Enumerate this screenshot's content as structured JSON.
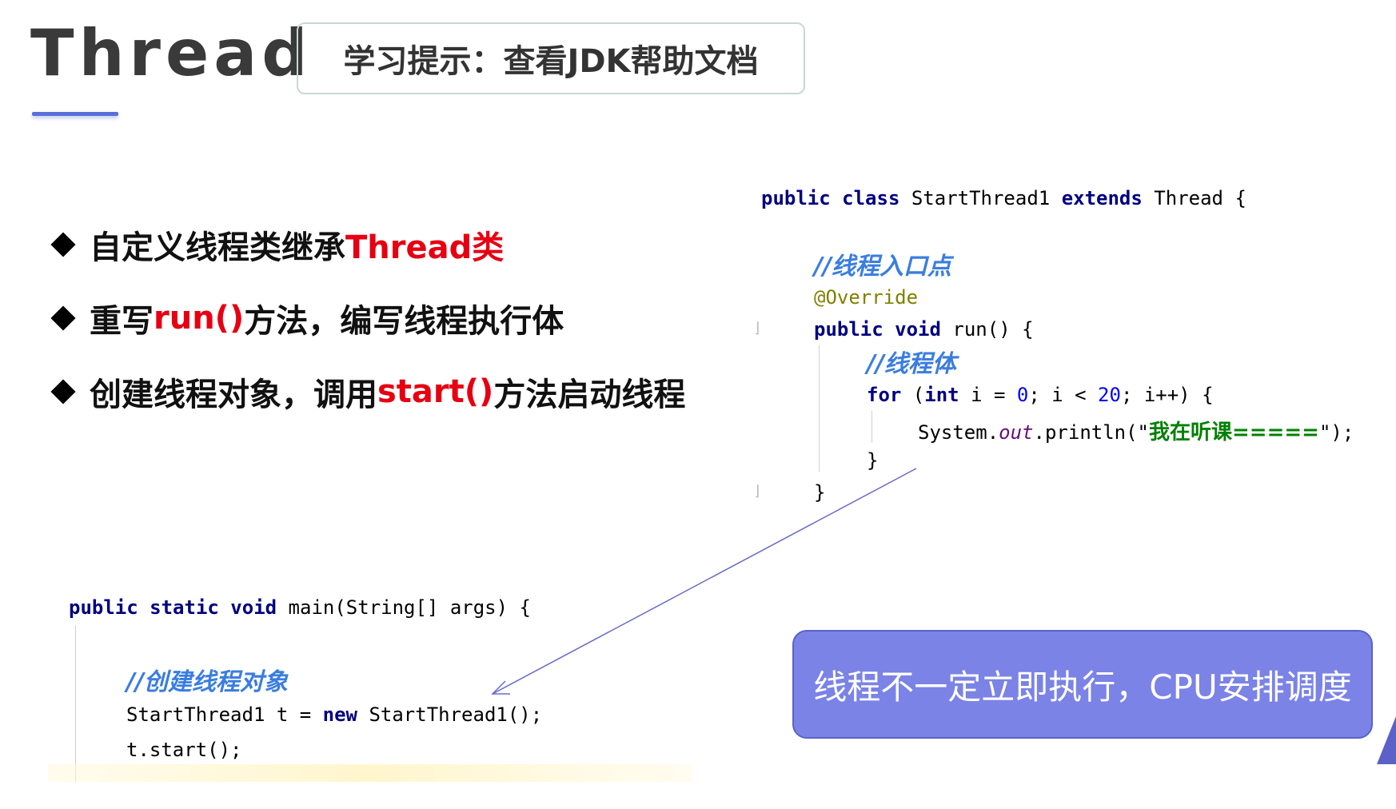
{
  "title": "Thread",
  "hint": "学习提示：查看JDK帮助文档",
  "bullets": [
    {
      "pre": "自定义线程类继承",
      "red": "Thread类",
      "post": ""
    },
    {
      "pre": "重写",
      "red": "run()",
      "post": "方法，编写线程执行体"
    },
    {
      "pre": "创建线程对象，调用",
      "red": "start()",
      "post": "方法启动线程"
    }
  ],
  "code_class": {
    "l1_kw": "public class",
    "l1_name": " StartThread1 ",
    "l1_ext": "extends",
    "l1_tail": " Thread {",
    "comment1": "//线程入口点",
    "annotation": "@Override",
    "l3_kw": "public void",
    "l3_tail": " run() {",
    "comment2": "//线程体",
    "for_kw": "for",
    "for_open": " (",
    "int_kw": "int",
    "for_mid1": " i = ",
    "n0": "0",
    "for_mid2": "; i < ",
    "n20": "20",
    "for_tail": "; i++) {",
    "sys": "System.",
    "out": "out",
    "println": ".println(\"",
    "str": "我在听课=====",
    "println_end": "\");",
    "close_brace": "}"
  },
  "code_main": {
    "l1_kw": "public static void",
    "l1_tail": " main(String[] args) {",
    "comment": "//创建线程对象",
    "l2_a": "StartThread1 t = ",
    "l2_new": "new",
    "l2_b": " StartThread1();",
    "l3": "t.start();"
  },
  "callout": "线程不一定立即执行，CPU安排调度",
  "colors": {
    "accent": "#5a6fd8",
    "red": "#e60012",
    "callout_bg": "#7b83e6"
  }
}
